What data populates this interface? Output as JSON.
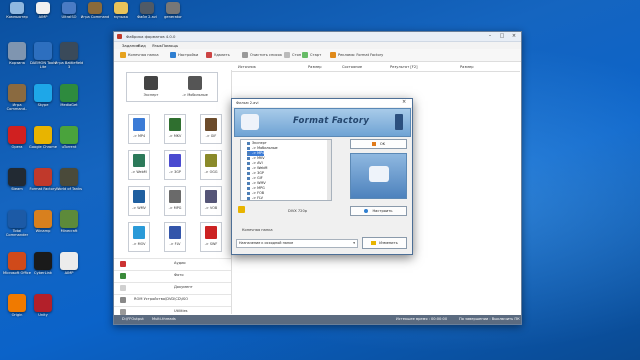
{
  "desktop": {
    "icons": [
      {
        "label": "Корзина",
        "color": "#7f95b0"
      },
      {
        "label": "DAEMON Tools Lite",
        "color": "#2d6fbf"
      },
      {
        "label": "Игра Battlefield 3",
        "color": "#3a4a5a"
      },
      {
        "label": "Игра Command..",
        "color": "#8a6a40"
      },
      {
        "label": "Skype",
        "color": "#1ea7e8"
      },
      {
        "label": "MediaGet",
        "color": "#2e8b3e"
      },
      {
        "label": "Opera",
        "color": "#d02020"
      },
      {
        "label": "Google Chrome",
        "color": "#e8b400"
      },
      {
        "label": "uTorrent",
        "color": "#4aa33c"
      },
      {
        "label": "Steam",
        "color": "#222a33"
      },
      {
        "label": "Format Factory",
        "color": "#c0392b"
      },
      {
        "label": "World of Tanks",
        "color": "#4a4a3a"
      },
      {
        "label": "Total Commander",
        "color": "#1c5aa6"
      },
      {
        "label": "Winamp",
        "color": "#d8801e"
      },
      {
        "label": "Minecraft",
        "color": "#5d8a3a"
      },
      {
        "label": "Microsoft Office",
        "color": "#d04a1a"
      },
      {
        "label": "CyberLink",
        "color": "#1a1a1a"
      },
      {
        "label": "AIMP",
        "color": "#ececec"
      },
      {
        "label": "Origin",
        "color": "#f07a00"
      },
      {
        "label": "Unity",
        "color": "#b3202a"
      }
    ],
    "topicons": [
      {
        "label": "Компьютер",
        "color": "#8fb8e0"
      },
      {
        "label": "AIMP",
        "color": "#f0f0f0"
      },
      {
        "label": "UltraISO",
        "color": "#4a7bc4"
      },
      {
        "label": "Игра Command",
        "color": "#8a6a3a"
      },
      {
        "label": "музыка",
        "color": "#e8c35a"
      },
      {
        "label": "Файл 2.avi",
        "color": "#505a66"
      },
      {
        "label": "generator",
        "color": "#777777"
      }
    ]
  },
  "app": {
    "title": "Фабрика форматов 4.0.0",
    "menu": [
      "Задание",
      "Вид",
      "Язык",
      "Помощь"
    ],
    "toolbar": [
      {
        "label": "Конечная папка",
        "color": "#e6a21e"
      },
      {
        "label": "Настройки",
        "color": "#2f7fd1"
      },
      {
        "label": "Удалить",
        "color": "#c44"
      },
      {
        "label": "Очистить список",
        "color": "#999"
      },
      {
        "label": "Стоп",
        "color": "#bbb"
      },
      {
        "label": "Старт",
        "color": "#6b6"
      },
      {
        "label": "Реклама: Format Factory",
        "color": "#e08a1a"
      }
    ],
    "columns": [
      "Источник",
      "Размер",
      "Состояние",
      "Результат [F2]",
      "Размер"
    ],
    "tiles_top": [
      {
        "label": "Эксперт",
        "color": "#444"
      },
      {
        "label": "-> Мобильные",
        "color": "#555"
      }
    ],
    "tiles": [
      {
        "label": "-> MP4",
        "color": "#3b7bd6"
      },
      {
        "label": "-> MKV",
        "color": "#2f6f2f"
      },
      {
        "label": "-> GIF",
        "color": "#6b4b2b"
      },
      {
        "label": "-> WebM",
        "color": "#2c7a5a"
      },
      {
        "label": "-> 3GP",
        "color": "#4a4ad0"
      },
      {
        "label": "-> OGG",
        "color": "#8a8a2a"
      },
      {
        "label": "-> WMV",
        "color": "#1f5fa0"
      },
      {
        "label": "-> MPG",
        "color": "#6a6a6a"
      },
      {
        "label": "-> VOB",
        "color": "#555577"
      },
      {
        "label": "-> MOV",
        "color": "#2a9ad8"
      },
      {
        "label": "-> FLV",
        "color": "#3355aa"
      },
      {
        "label": "-> SWF",
        "color": "#c22"
      }
    ],
    "categories": [
      {
        "label": "Аудио",
        "color": "#c33"
      },
      {
        "label": "Фото",
        "color": "#3a8a3a"
      },
      {
        "label": "Документ",
        "color": "#d0d0d0"
      },
      {
        "label": "ROM Устройство\\DVD\\CD\\ISO",
        "color": "#888"
      },
      {
        "label": "Utilities",
        "color": "#999"
      }
    ],
    "status": {
      "folder": "D:\\FFOutput",
      "mode": "Multi-threads",
      "time": "Истекшее время : 00:00:00",
      "finish": "По завершении : Выключить ПК"
    }
  },
  "dialog": {
    "title": "Фильм 2.avi",
    "banner": "Format Factory",
    "tree": [
      "Эксперт",
      "-> Мобильные",
      "-> MP4",
      "-> MKV",
      "-> AVI",
      "-> WebM",
      "-> 3GP",
      "-> GIF",
      "-> WMV",
      "-> MPG",
      "-> FOB",
      "-> FLV"
    ],
    "ok_label": "OK",
    "size_text": "DIVX 720p",
    "settings_label": "Настроить",
    "folder_label": "Конечная папка",
    "folder_value": "Назначение к исходной папке",
    "change_label": "Изменить"
  }
}
